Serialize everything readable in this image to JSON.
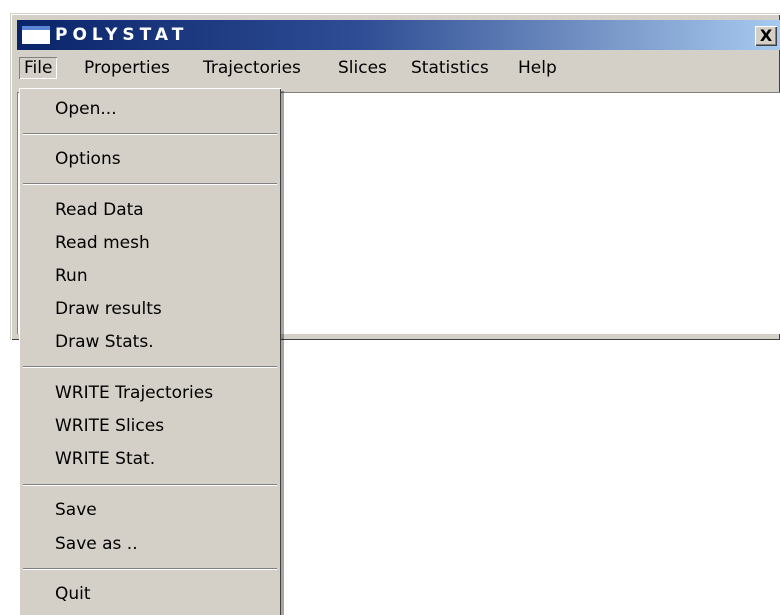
{
  "window": {
    "title": "POLYSTAT",
    "close_label": "X"
  },
  "menubar": {
    "items": [
      {
        "label": "File"
      },
      {
        "label": "Properties"
      },
      {
        "label": "Trajectories"
      },
      {
        "label": "Slices"
      },
      {
        "label": "Statistics"
      },
      {
        "label": "Help"
      }
    ]
  },
  "file_menu": {
    "items": [
      {
        "label": "Open..."
      },
      {
        "label": "Options"
      },
      {
        "label": "Read Data"
      },
      {
        "label": "Read mesh"
      },
      {
        "label": "Run"
      },
      {
        "label": "Draw results"
      },
      {
        "label": "Draw Stats."
      },
      {
        "label": "WRITE Trajectories"
      },
      {
        "label": "WRITE Slices"
      },
      {
        "label": "WRITE Stat."
      },
      {
        "label": "Save"
      },
      {
        "label": "Save as .."
      },
      {
        "label": "Quit"
      }
    ]
  },
  "colors": {
    "title_bar_start": "#0a246a",
    "title_bar_end": "#a6caf0",
    "chrome": "#d4d0c8"
  }
}
